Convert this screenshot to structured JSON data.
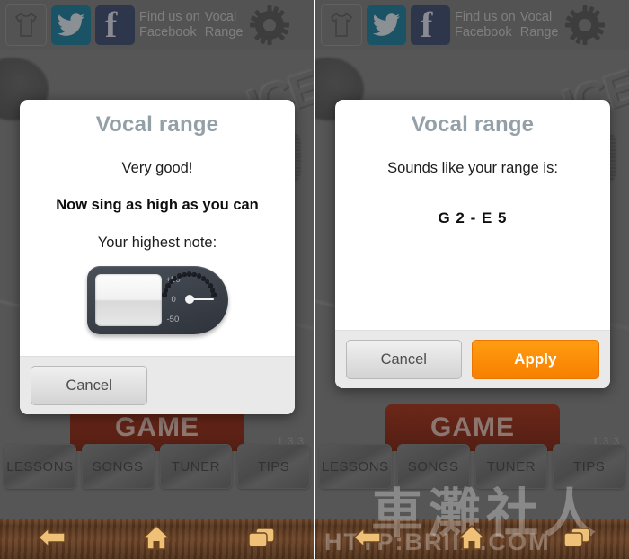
{
  "topbar": {
    "shirt_icon": "tshirt-icon",
    "twitter_icon": "twitter-bird-icon",
    "facebook_icon": "facebook-f-icon",
    "facebook_line1": "Find us on",
    "facebook_line2": "Facebook",
    "vocal_line1": "Vocal",
    "vocal_line2": "Range",
    "gear_icon": "gear-icon"
  },
  "background": {
    "logo_text": "ICE",
    "game_button": "GAME",
    "version": "1.3.3",
    "tabs": [
      "LESSONS",
      "SONGS",
      "TUNER",
      "TIPS"
    ]
  },
  "navbar": {
    "back_icon": "back-arrow-icon",
    "home_icon": "home-icon",
    "recents_icon": "recent-apps-icon"
  },
  "left_dialog": {
    "title": "Vocal range",
    "line1": "Very good!",
    "line2": "Now sing as high as you can",
    "line3": "Your highest note:",
    "tuner": {
      "scale_top": "+50",
      "scale_mid": "0",
      "scale_bottom": "-50",
      "dot_count": 15
    },
    "cancel_label": "Cancel"
  },
  "right_dialog": {
    "title": "Vocal range",
    "line1": "Sounds like your range is:",
    "range_value": "G 2 - E 5",
    "cancel_label": "Cancel",
    "apply_label": "Apply"
  },
  "watermark": {
    "cjk": "車灘社人",
    "url": "HTTP:BRIIA.COM"
  },
  "colors": {
    "dialog_title": "#93a0a8",
    "apply_button": "#f88c06",
    "twitter": "#1b6b86",
    "facebook": "#35415f",
    "game_button": "#8d2c17"
  }
}
